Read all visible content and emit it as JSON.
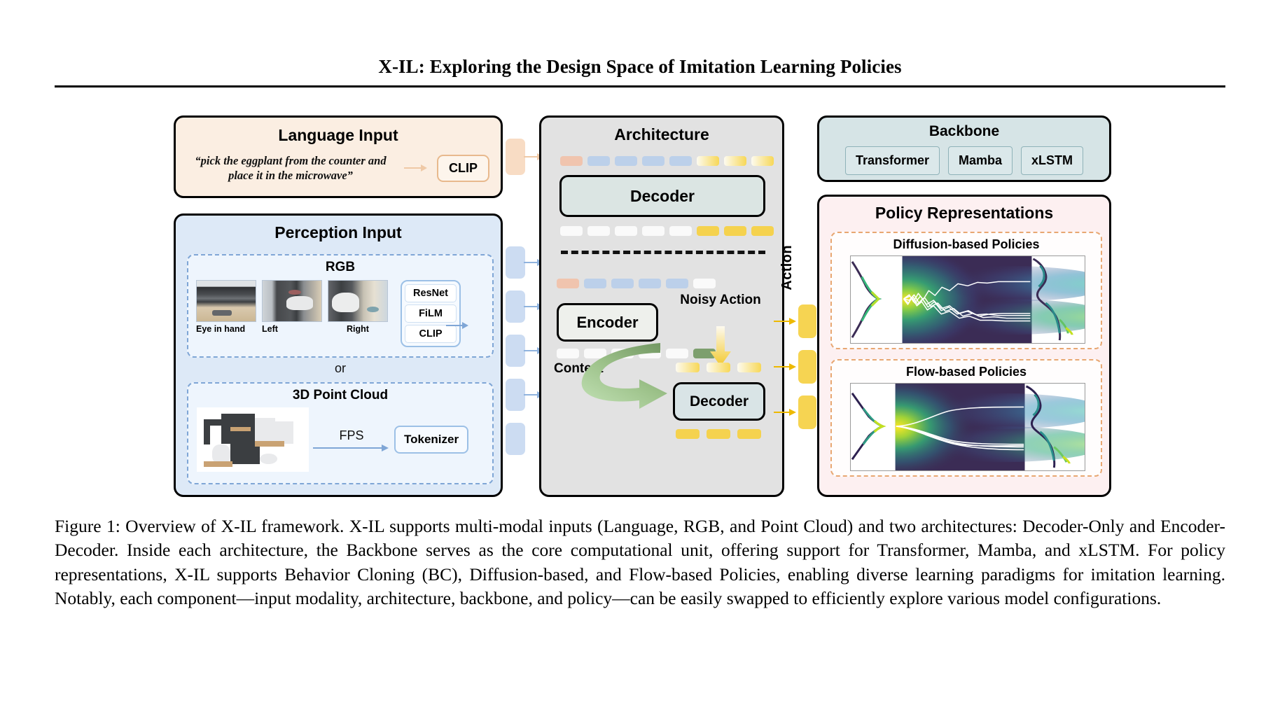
{
  "paper": {
    "title": "X-IL: Exploring the Design Space of Imitation Learning Policies",
    "caption": "Figure 1: Overview of X-IL framework. X-IL supports multi-modal inputs (Language, RGB, and Point Cloud) and two architectures: Decoder-Only and Encoder-Decoder. Inside each architecture, the Backbone serves as the core computational unit, offering support for Transformer, Mamba, and xLSTM. For policy representations, X-IL supports Behavior Cloning (BC), Diffusion-based, and Flow-based Policies, enabling diverse learning paradigms for imitation learning. Notably, each component—input modality, architecture, backbone, and policy—can be easily swapped to efficiently explore various model configurations."
  },
  "language_input": {
    "title": "Language Input",
    "instruction": "“pick the eggplant from the counter and place it in the microwave”",
    "encoder": "CLIP",
    "bg_color": "#fbeee2",
    "accent_color": "#efc9a6"
  },
  "perception_input": {
    "title": "Perception Input",
    "bg_color": "#dde9f7",
    "accent_color": "#7fa6d6",
    "rgb": {
      "title": "RGB",
      "views": [
        {
          "label": "Eye in hand"
        },
        {
          "label": "Left"
        },
        {
          "label": "Right"
        }
      ],
      "encoders": [
        "ResNet",
        "FiLM",
        "CLIP"
      ]
    },
    "separator": "or",
    "point_cloud": {
      "title": "3D Point Cloud",
      "operation": "FPS",
      "encoder": "Tokenizer"
    }
  },
  "architecture": {
    "title": "Architecture",
    "bg_color": "#e2e2e2",
    "decoder_only": {
      "block_label": "Decoder",
      "input_tokens": [
        "peach",
        "blue",
        "blue",
        "blue",
        "blue",
        "grad",
        "grad",
        "grad"
      ],
      "output_tokens": [
        "white",
        "white",
        "white",
        "white",
        "white",
        "yellow",
        "yellow",
        "yellow"
      ]
    },
    "encoder_decoder": {
      "encoder_label": "Encoder",
      "decoder_label": "Decoder",
      "context_label": "Context",
      "noisy_action_label": "Noisy Action",
      "encoder_input_tokens": [
        "peach",
        "blue",
        "blue",
        "blue",
        "blue",
        "white"
      ],
      "encoder_output_tokens": [
        "white",
        "white",
        "white",
        "white",
        "white",
        "green"
      ],
      "decoder_input_tokens": [
        "grad",
        "grad",
        "grad"
      ],
      "decoder_output_tokens": [
        "yellow",
        "yellow",
        "yellow"
      ]
    }
  },
  "action": {
    "label": "Action",
    "token_color": "#f6d452",
    "arrow_color": "#edb900",
    "count": 3
  },
  "backbone": {
    "title": "Backbone",
    "bg_color": "#d6e4e6",
    "options": [
      "Transformer",
      "Mamba",
      "xLSTM"
    ]
  },
  "policy_representations": {
    "title": "Policy Representations",
    "bg_color": "#fdf0f1",
    "accent_color": "#e8a772",
    "items": [
      {
        "title": "Diffusion-based Policies",
        "trajectory_style": "noisy"
      },
      {
        "title": "Flow-based Policies",
        "trajectory_style": "smooth"
      }
    ]
  },
  "connectors": {
    "language_tokens": 1,
    "perception_tokens": 5,
    "language_token_color": "#f8dcc4",
    "perception_token_color": "#ccdcf2"
  }
}
